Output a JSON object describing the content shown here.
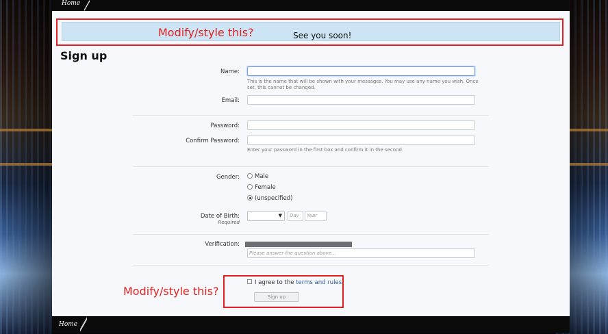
{
  "breadcrumb": {
    "home": "Home"
  },
  "footer": {
    "home": "Home"
  },
  "notice": {
    "text": "See you soon!"
  },
  "annotations": {
    "top": "Modify/style this?",
    "bottom": "Modify/style this?"
  },
  "page": {
    "title": "Sign up"
  },
  "form": {
    "name_label": "Name:",
    "name_hint": "This is the name that will be shown with your messages. You may use any name you wish. Once set, this cannot be changed.",
    "email_label": "Email:",
    "password_label": "Password:",
    "confirm_label": "Confirm Password:",
    "password_hint": "Enter your password in the first box and confirm it in the second.",
    "gender_label": "Gender:",
    "gender_options": [
      "Male",
      "Female",
      "(unspecified)"
    ],
    "gender_selected": "(unspecified)",
    "dob_label": "Date of Birth:",
    "dob_required": "Required",
    "dob_day_placeholder": "Day",
    "dob_year_placeholder": "Year",
    "verification_label": "Verification:",
    "verification_placeholder": "Please answer the question above...",
    "agree_text": "I agree to the",
    "agree_link": "terms and rules",
    "agree_end": ".",
    "submit": "Sign up"
  },
  "colors": {
    "annotation": "#e01f1f",
    "notice_bg": "#cce4f3",
    "link": "#2a5aa0"
  }
}
